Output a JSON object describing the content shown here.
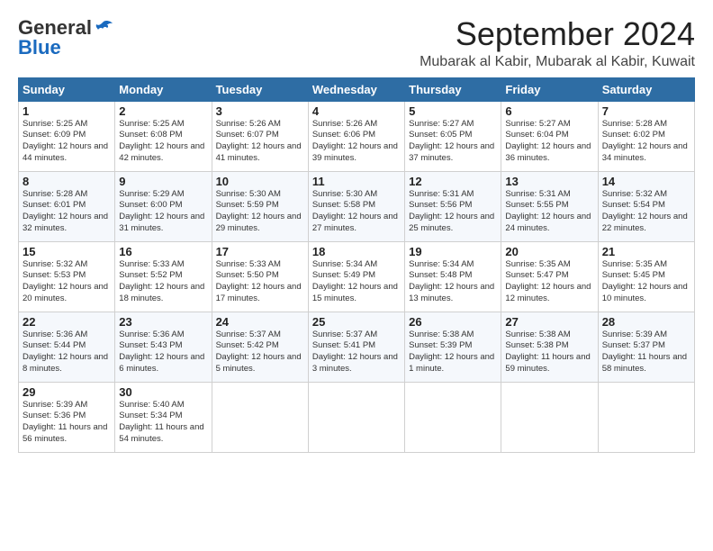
{
  "logo": {
    "general": "General",
    "blue": "Blue"
  },
  "title": "September 2024",
  "location": "Mubarak al Kabir, Mubarak al Kabir, Kuwait",
  "days_of_week": [
    "Sunday",
    "Monday",
    "Tuesday",
    "Wednesday",
    "Thursday",
    "Friday",
    "Saturday"
  ],
  "weeks": [
    [
      {
        "day": "1",
        "sunrise": "5:25 AM",
        "sunset": "6:09 PM",
        "daylight": "12 hours and 44 minutes."
      },
      {
        "day": "2",
        "sunrise": "5:25 AM",
        "sunset": "6:08 PM",
        "daylight": "12 hours and 42 minutes."
      },
      {
        "day": "3",
        "sunrise": "5:26 AM",
        "sunset": "6:07 PM",
        "daylight": "12 hours and 41 minutes."
      },
      {
        "day": "4",
        "sunrise": "5:26 AM",
        "sunset": "6:06 PM",
        "daylight": "12 hours and 39 minutes."
      },
      {
        "day": "5",
        "sunrise": "5:27 AM",
        "sunset": "6:05 PM",
        "daylight": "12 hours and 37 minutes."
      },
      {
        "day": "6",
        "sunrise": "5:27 AM",
        "sunset": "6:04 PM",
        "daylight": "12 hours and 36 minutes."
      },
      {
        "day": "7",
        "sunrise": "5:28 AM",
        "sunset": "6:02 PM",
        "daylight": "12 hours and 34 minutes."
      }
    ],
    [
      {
        "day": "8",
        "sunrise": "5:28 AM",
        "sunset": "6:01 PM",
        "daylight": "12 hours and 32 minutes."
      },
      {
        "day": "9",
        "sunrise": "5:29 AM",
        "sunset": "6:00 PM",
        "daylight": "12 hours and 31 minutes."
      },
      {
        "day": "10",
        "sunrise": "5:30 AM",
        "sunset": "5:59 PM",
        "daylight": "12 hours and 29 minutes."
      },
      {
        "day": "11",
        "sunrise": "5:30 AM",
        "sunset": "5:58 PM",
        "daylight": "12 hours and 27 minutes."
      },
      {
        "day": "12",
        "sunrise": "5:31 AM",
        "sunset": "5:56 PM",
        "daylight": "12 hours and 25 minutes."
      },
      {
        "day": "13",
        "sunrise": "5:31 AM",
        "sunset": "5:55 PM",
        "daylight": "12 hours and 24 minutes."
      },
      {
        "day": "14",
        "sunrise": "5:32 AM",
        "sunset": "5:54 PM",
        "daylight": "12 hours and 22 minutes."
      }
    ],
    [
      {
        "day": "15",
        "sunrise": "5:32 AM",
        "sunset": "5:53 PM",
        "daylight": "12 hours and 20 minutes."
      },
      {
        "day": "16",
        "sunrise": "5:33 AM",
        "sunset": "5:52 PM",
        "daylight": "12 hours and 18 minutes."
      },
      {
        "day": "17",
        "sunrise": "5:33 AM",
        "sunset": "5:50 PM",
        "daylight": "12 hours and 17 minutes."
      },
      {
        "day": "18",
        "sunrise": "5:34 AM",
        "sunset": "5:49 PM",
        "daylight": "12 hours and 15 minutes."
      },
      {
        "day": "19",
        "sunrise": "5:34 AM",
        "sunset": "5:48 PM",
        "daylight": "12 hours and 13 minutes."
      },
      {
        "day": "20",
        "sunrise": "5:35 AM",
        "sunset": "5:47 PM",
        "daylight": "12 hours and 12 minutes."
      },
      {
        "day": "21",
        "sunrise": "5:35 AM",
        "sunset": "5:45 PM",
        "daylight": "12 hours and 10 minutes."
      }
    ],
    [
      {
        "day": "22",
        "sunrise": "5:36 AM",
        "sunset": "5:44 PM",
        "daylight": "12 hours and 8 minutes."
      },
      {
        "day": "23",
        "sunrise": "5:36 AM",
        "sunset": "5:43 PM",
        "daylight": "12 hours and 6 minutes."
      },
      {
        "day": "24",
        "sunrise": "5:37 AM",
        "sunset": "5:42 PM",
        "daylight": "12 hours and 5 minutes."
      },
      {
        "day": "25",
        "sunrise": "5:37 AM",
        "sunset": "5:41 PM",
        "daylight": "12 hours and 3 minutes."
      },
      {
        "day": "26",
        "sunrise": "5:38 AM",
        "sunset": "5:39 PM",
        "daylight": "12 hours and 1 minute."
      },
      {
        "day": "27",
        "sunrise": "5:38 AM",
        "sunset": "5:38 PM",
        "daylight": "11 hours and 59 minutes."
      },
      {
        "day": "28",
        "sunrise": "5:39 AM",
        "sunset": "5:37 PM",
        "daylight": "11 hours and 58 minutes."
      }
    ],
    [
      {
        "day": "29",
        "sunrise": "5:39 AM",
        "sunset": "5:36 PM",
        "daylight": "11 hours and 56 minutes."
      },
      {
        "day": "30",
        "sunrise": "5:40 AM",
        "sunset": "5:34 PM",
        "daylight": "11 hours and 54 minutes."
      },
      null,
      null,
      null,
      null,
      null
    ]
  ]
}
